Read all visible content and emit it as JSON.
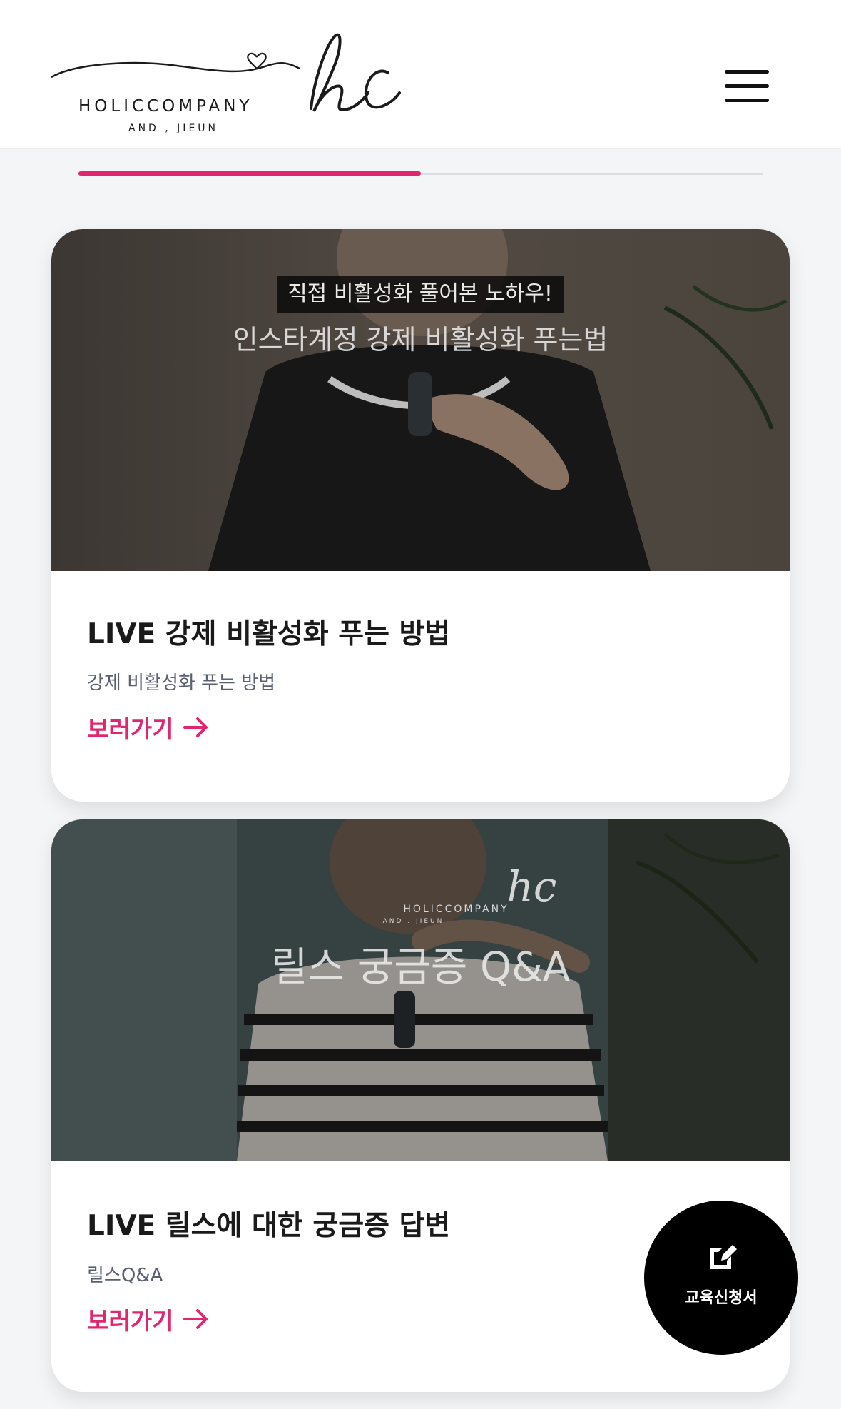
{
  "header": {
    "logo": {
      "brand": "HOLICCOMPANY",
      "sub": "AND , JIEUN",
      "mark": "hc"
    },
    "menu_icon": "hamburger-icon"
  },
  "tabs": {
    "active_index": 0,
    "count": 2,
    "active_fraction": 0.5
  },
  "cards": [
    {
      "thumb_tag": "직접 비활성화 풀어본 노하우!",
      "thumb_caption": "인스타계정 강제 비활성화 푸는법",
      "title": "LIVE 강제 비활성화 푸는 방법",
      "desc": "강제 비활성화 푸는 방법",
      "link": "보러가기"
    },
    {
      "thumb_brand": "HOLICCOMPANY",
      "thumb_brand_sub": "AND . JIEUN",
      "thumb_mark": "hc",
      "thumb_caption": "릴스 궁금증 Q&A",
      "title": "LIVE 릴스에 대한 궁금증 답변",
      "desc": "릴스Q&A",
      "link": "보러가기"
    }
  ],
  "fab": {
    "label": "교육신청서",
    "icon": "edit-icon"
  },
  "colors": {
    "accent": "#e0266f",
    "fab_bg": "#000000"
  }
}
